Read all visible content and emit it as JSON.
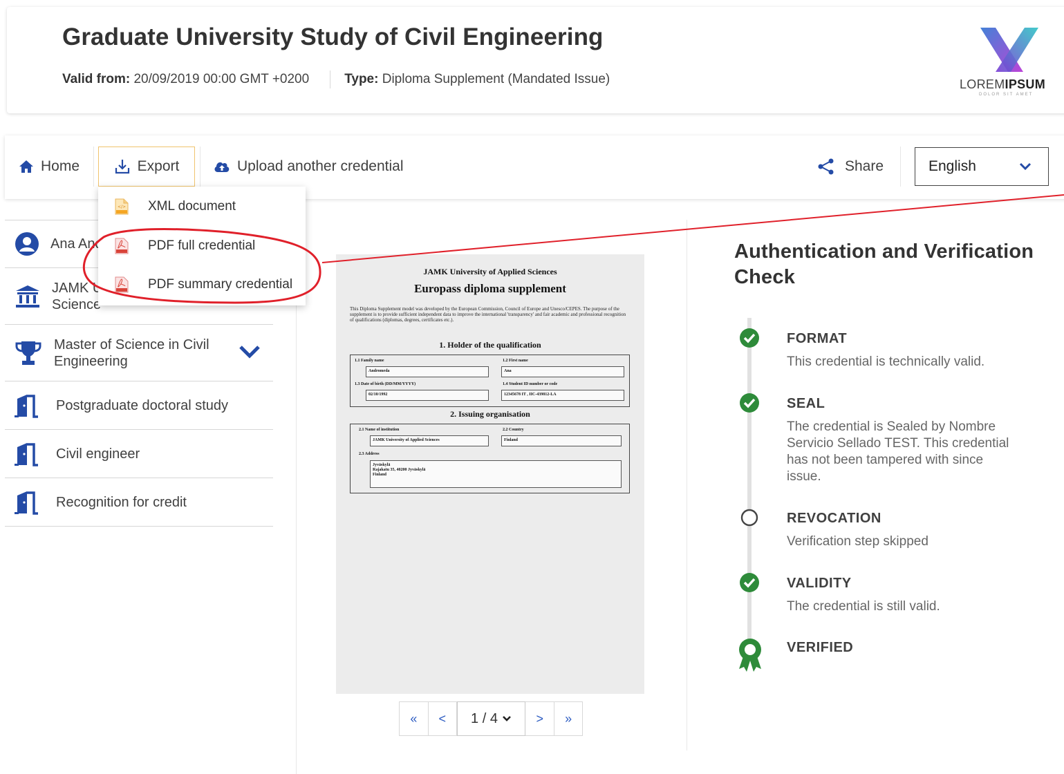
{
  "header": {
    "title": "Graduate University Study of Civil Engineering",
    "valid_from_label": "Valid from:",
    "valid_from_value": "20/09/2019 00:00 GMT +0200",
    "type_label": "Type:",
    "type_value": "Diploma Supplement (Mandated Issue)",
    "logo": {
      "text_regular": "LOREM",
      "text_bold": "IPSUM",
      "subtext": "DOLOR SIT AMET",
      "colors": [
        "#3a7bd5",
        "#b83ad5",
        "#2ec4c4"
      ]
    }
  },
  "toolbar": {
    "home_label": "Home",
    "export_label": "Export",
    "upload_label": "Upload another credential",
    "share_label": "Share",
    "language_value": "English"
  },
  "export_menu": {
    "items": [
      {
        "label": "XML document",
        "icon": "xml-file-icon"
      },
      {
        "label": "PDF full credential",
        "icon": "pdf-file-icon"
      },
      {
        "label": "PDF summary credential",
        "icon": "pdf-file-icon"
      }
    ]
  },
  "sidebar": {
    "items": [
      {
        "label": "Ana And",
        "icon": "user-icon"
      },
      {
        "label": "JAMK U",
        "label2": "Science",
        "icon": "institution-icon"
      },
      {
        "label": "Master of Science in Civil",
        "label2": "Engineering",
        "icon": "trophy-icon"
      },
      {
        "label": "Postgraduate doctoral study",
        "icon": "door-exit-icon"
      },
      {
        "label": "Civil engineer",
        "icon": "door-exit-icon"
      },
      {
        "label": "Recognition for credit",
        "icon": "door-exit-icon"
      }
    ]
  },
  "document": {
    "institution": "JAMK University of Applied Sciences",
    "title": "Europass diploma supplement",
    "intro": "This Diploma Supplement model was developed by the European Commission, Council of Europe and Unesco/CEPES. The purpose of the supplement is to provide sufficient independent data to improve the international 'transparency' and fair academic and professional recognition of qualifications (diplomas, degrees, certificates etc.).",
    "section1": "1. Holder of the qualification",
    "f11_label": "1.1   Family name",
    "f11_value": "Andromeda",
    "f12_label": "1.2   First name",
    "f12_value": "Ana",
    "f13_label": "1.3   Date of birth (DD/MM/YYYY)",
    "f13_value": "02/10/1992",
    "f14_label": "1.4   Student ID number or code",
    "f14_value": "12345678 IT , IIC-439812-LA",
    "section2": "2. Issuing organisation",
    "f21_label": "2.1   Name of institution",
    "f21_value": "JAMK University of Applied Sciences",
    "f22_label": "2.2   Country",
    "f22_value": "Finland",
    "f23_label": "2.3   Address",
    "f23_line1": "Jyväskylä",
    "f23_line2": "Rajakatu 35, 40200 Jyväskylä",
    "f23_line3": "Finland"
  },
  "pager": {
    "first": "«",
    "prev": "<",
    "current": "1 / 4",
    "next": ">",
    "last": "»"
  },
  "verification": {
    "title": "Authentication and Verification Check",
    "steps": [
      {
        "name": "FORMAT",
        "desc": "This credential is technically valid.",
        "status": "passed"
      },
      {
        "name": "SEAL",
        "desc": "The credential is Sealed by Nombre Servicio Sellado TEST. This credential has not been tampered with since issue.",
        "status": "passed"
      },
      {
        "name": "REVOCATION",
        "desc": "Verification step skipped",
        "status": "skipped"
      },
      {
        "name": "VALIDITY",
        "desc": "The credential is still valid.",
        "status": "passed"
      },
      {
        "name": "VERIFIED",
        "desc": "",
        "status": "verified"
      }
    ],
    "success_color": "#2e8b3a"
  }
}
